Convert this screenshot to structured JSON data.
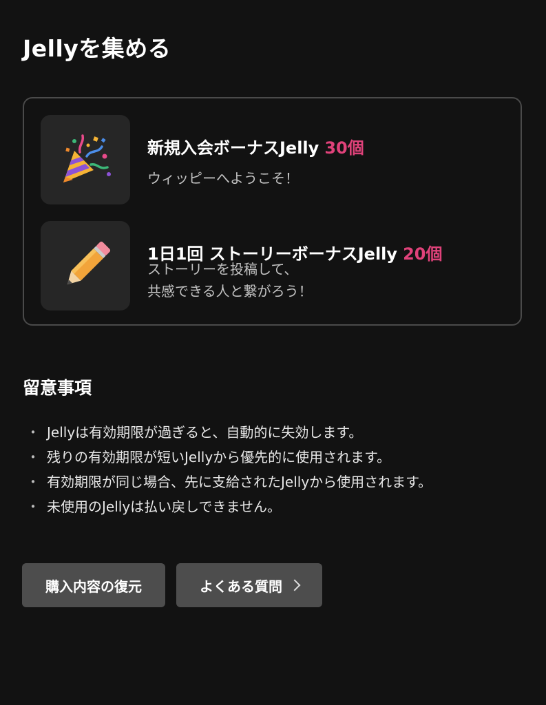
{
  "page": {
    "title": "Jellyを集める"
  },
  "bonuses": [
    {
      "title": "新規入会ボーナスJelly",
      "amount": "30個",
      "desc_lines": [
        "ウィッピーへようこそ！"
      ],
      "icon": "party-popper-icon"
    },
    {
      "title": "1日1回 ストーリーボーナスJelly",
      "amount": "20個",
      "desc_lines": [
        "ストーリーを投稿して、",
        "共感できる人と繋がろう！"
      ],
      "icon": "pencil-icon"
    }
  ],
  "notes": {
    "title": "留意事項",
    "bullet": "・",
    "items": [
      "Jellyは有効期限が過ぎると、自動的に失効します。",
      "残りの有効期限が短いJellyから優先的に使用されます。",
      "有効期限が同じ場合、先に支給されたJellyから使用されます。",
      "未使用のJellyは払い戻しできません。"
    ]
  },
  "buttons": {
    "restore_label": "購入内容の復元",
    "faq_label": "よくある質問"
  },
  "colors": {
    "background": "#121212",
    "accent": "#e0427a",
    "card_border": "#4a4a4a",
    "icon_box": "#262626",
    "button": "#4d4d4d"
  }
}
